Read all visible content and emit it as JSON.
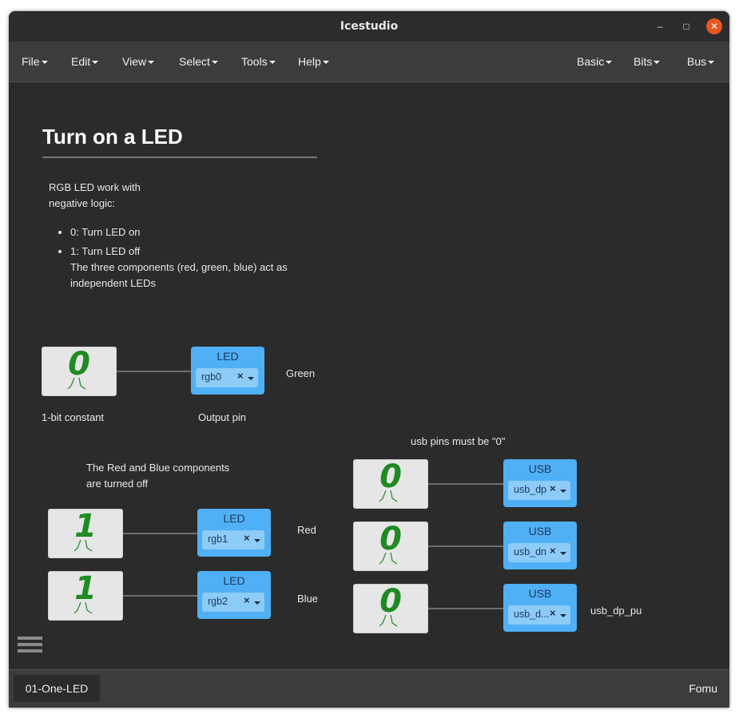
{
  "window": {
    "title": "Icestudio"
  },
  "menu": {
    "left": [
      "File",
      "Edit",
      "View",
      "Select",
      "Tools",
      "Help"
    ],
    "right": [
      "Basic",
      "Bits",
      "Bus"
    ]
  },
  "canvas": {
    "heading": "Turn on a LED",
    "intro_line1": "RGB LED work with",
    "intro_line2": "negative logic:",
    "bullet1": "0: Turn LED on",
    "bullet2": "1: Turn LED off",
    "bullet2_line2": "The three components (red, green, blue) act as",
    "bullet2_line3": "independent LEDs",
    "const_label": "1-bit constant",
    "output_label": "Output pin",
    "rb_note_line1": "The Red and Blue components",
    "rb_note_line2": "are turned off",
    "usb_note": "usb pins must be \"0\"",
    "blocks": {
      "const_green": "0",
      "const_red": "1",
      "const_blue": "1",
      "const_usb_dp": "0",
      "const_usb_dn": "0",
      "const_usb_dp_pu": "0"
    },
    "pins": {
      "green": {
        "label": "LED",
        "value": "rgb0",
        "name": "Green"
      },
      "red": {
        "label": "LED",
        "value": "rgb1",
        "name": "Red"
      },
      "blue": {
        "label": "LED",
        "value": "rgb2",
        "name": "Blue"
      },
      "usb_dp": {
        "label": "USB",
        "value": "usb_dp"
      },
      "usb_dn": {
        "label": "USB",
        "value": "usb_dn"
      },
      "usb_dp_pu": {
        "label": "USB",
        "value": "usb_d...",
        "name": "usb_dp_pu"
      }
    },
    "clear_symbol": "×"
  },
  "status": {
    "tab": "01-One-LED",
    "board": "Fomu"
  },
  "colors": {
    "accent_close": "#e95420",
    "pin_block": "#4fb0f6",
    "constant_digit": "#1e8b23"
  },
  "icons": [
    "minimize-icon",
    "maximize-icon",
    "close-icon",
    "hamburger-menu-icon",
    "chevron-down-icon"
  ]
}
